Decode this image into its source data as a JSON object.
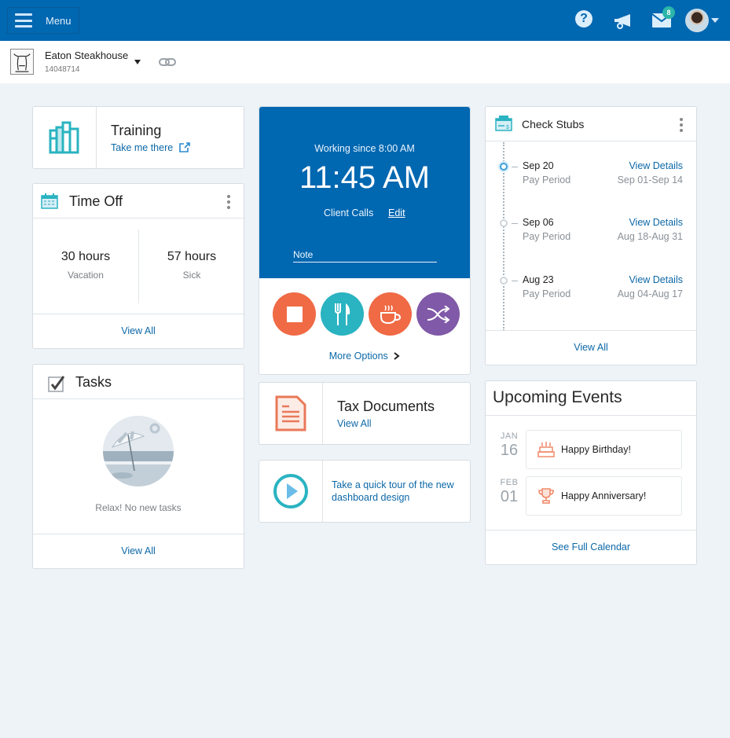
{
  "topbar": {
    "menu_label": "Menu",
    "icons": [
      "help-icon",
      "megaphone-icon",
      "mail-icon",
      "avatar"
    ],
    "mail_badge": "8"
  },
  "company": {
    "name": "Eaton Steakhouse",
    "id": "14048714"
  },
  "training": {
    "title": "Training",
    "link": "Take me there"
  },
  "time_off": {
    "title": "Time Off",
    "balances": [
      {
        "value": "30 hours",
        "label": "Vacation"
      },
      {
        "value": "57 hours",
        "label": "Sick"
      }
    ],
    "footer": "View All"
  },
  "tasks": {
    "title": "Tasks",
    "empty_message": "Relax! No new tasks",
    "footer": "View All"
  },
  "clock": {
    "working_since": "Working since 8:00 AM",
    "time": "11:45 AM",
    "task": "Client Calls",
    "edit_label": "Edit",
    "note_placeholder": "Note",
    "actions": [
      {
        "name": "stop",
        "icon": "stop-icon",
        "color": "#ef6a45"
      },
      {
        "name": "meal",
        "icon": "fork-knife-icon",
        "color": "#2ab3c1"
      },
      {
        "name": "break",
        "icon": "coffee-cup-icon",
        "color": "#ef6a45"
      },
      {
        "name": "transfer",
        "icon": "shuffle-icon",
        "color": "#8059a8"
      }
    ],
    "more_options": "More Options"
  },
  "tax_documents": {
    "title": "Tax Documents",
    "link": "View All"
  },
  "tour": {
    "text": "Take a quick tour of the new dashboard design"
  },
  "check_stubs": {
    "title": "Check Stubs",
    "items": [
      {
        "date": "Sep 20",
        "label": "Pay Period",
        "details": "View Details",
        "range": "Sep 01-Sep 14"
      },
      {
        "date": "Sep 06",
        "label": "Pay Period",
        "details": "View Details",
        "range": "Aug 18-Aug 31"
      },
      {
        "date": "Aug 23",
        "label": "Pay Period",
        "details": "View Details",
        "range": "Aug 04-Aug 17"
      }
    ],
    "footer": "View All"
  },
  "events": {
    "title": "Upcoming Events",
    "items": [
      {
        "month": "JAN",
        "day": "16",
        "text": "Happy Birthday!",
        "icon": "cake-icon"
      },
      {
        "month": "FEB",
        "day": "01",
        "text": "Happy Anniversary!",
        "icon": "trophy-icon"
      }
    ],
    "footer": "See Full Calendar"
  },
  "colors": {
    "brand": "#0067b1",
    "link": "#0d68a8",
    "teal": "#2ab3c1",
    "orange": "#ef6a45",
    "purple": "#8059a8"
  }
}
